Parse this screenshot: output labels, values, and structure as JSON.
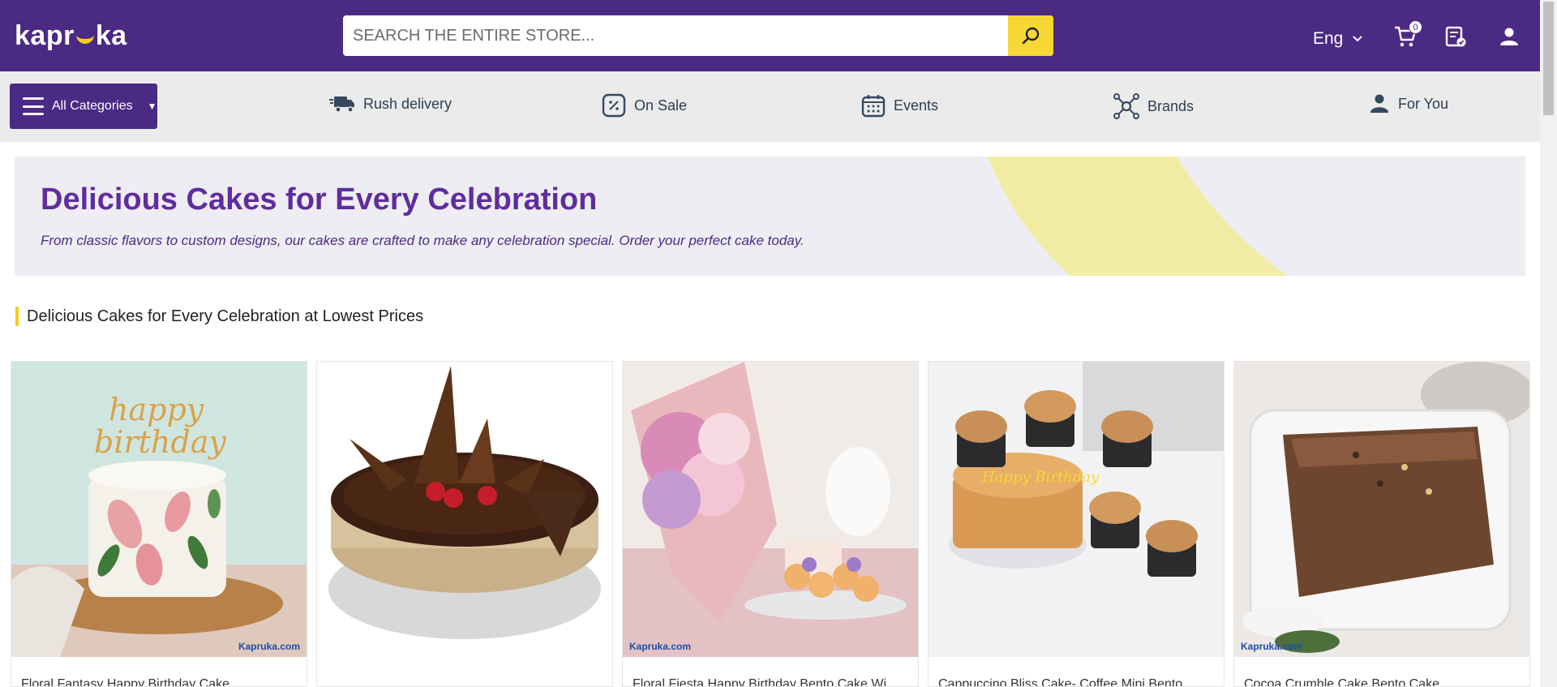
{
  "header": {
    "logo": {
      "left": "kapr",
      "right": "ka"
    },
    "search": {
      "placeholder": "SEARCH THE ENTIRE STORE..."
    },
    "language": "Eng",
    "cart_count": "0"
  },
  "nav": {
    "all_categories": "All Categories",
    "items": [
      {
        "label": "Rush delivery",
        "icon": "truck-icon"
      },
      {
        "label": "On Sale",
        "icon": "percent-tag-icon"
      },
      {
        "label": "Events",
        "icon": "calendar-icon"
      },
      {
        "label": "Brands",
        "icon": "network-icon"
      },
      {
        "label": "For You",
        "icon": "user-icon"
      }
    ]
  },
  "banner": {
    "title": "Delicious Cakes for Every Celebration",
    "subtitle": "From classic flavors to custom designs, our cakes are crafted to make any celebration special. Order your perfect cake today."
  },
  "section": {
    "heading": "Delicious Cakes for Every Celebration at Lowest Prices"
  },
  "products": [
    {
      "name": "Floral Fantasy Happy Birthday Cake",
      "topper_line1": "happy",
      "topper_line2": "birthday",
      "watermark": "Kapruka.com"
    },
    {
      "name": ""
    },
    {
      "name": "Floral Fiesta Happy Birthday Bento Cake Wi...",
      "watermark": "Kapruka.com"
    },
    {
      "name": "Cappuccino Bliss Cake- Coffee Mini Bento...",
      "topper": "Happy Birthday"
    },
    {
      "name": "Cocoa Crumble Cake Bento Cake",
      "watermark": "Kapruka.com"
    }
  ],
  "colors": {
    "brand_purple": "#4a2a82",
    "accent_yellow": "#f5d835",
    "banner_title": "#5f2d9e"
  }
}
